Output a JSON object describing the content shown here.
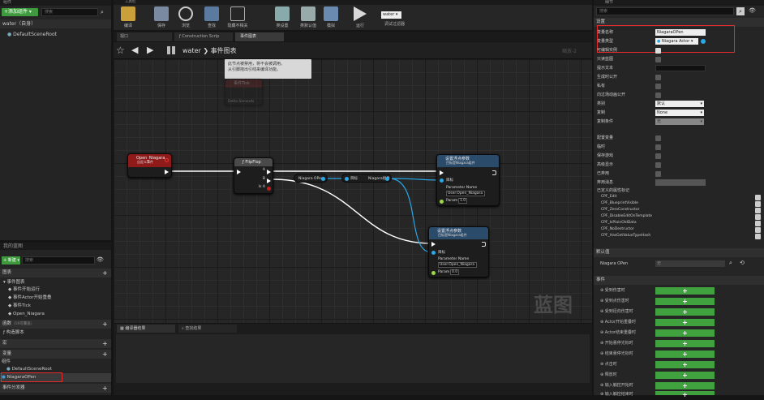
{
  "left_top": {
    "header": "组件",
    "add_button": "+添加组件 ▾",
    "search_placeholder": "搜索",
    "root_item": "water（自身）",
    "child_item": "DefaultSceneRoot"
  },
  "mybp": {
    "header": "我的蓝图",
    "new_button": "+ 新建 ▾",
    "search_placeholder": "搜索",
    "graphs_label": "图表",
    "event_graph": "事件图表",
    "events": [
      "事件开始运行",
      "事件Actor开始重叠",
      "事件Tick",
      "Open_Niagara"
    ],
    "functions_label": "函数",
    "functions_count": "（19可覆盖）",
    "construction": "构造脚本",
    "macros_label": "宏",
    "variables_label": "变量",
    "components_label": "组件",
    "comp_items": [
      "DefaultSceneRoot",
      "NiagaraOPen"
    ],
    "dispatchers_label": "事件分发器"
  },
  "toolbar": {
    "tab": "工具栏",
    "items": [
      "编译",
      "保存",
      "浏览",
      "查找",
      "隐藏不相关",
      "类设置",
      "类默认值",
      "模拟",
      "运行"
    ],
    "debug_label": "water ▾",
    "debug_filter": "调试过滤器"
  },
  "graph_tabs": {
    "viewport": "视口",
    "construction": "Construction Scrip",
    "event_graph": "事件图表"
  },
  "breadcrumb": {
    "root": "water",
    "arrow": "❯",
    "current": "事件图表",
    "zoom": "缩放-2"
  },
  "comment": {
    "text1": "此节点被禁用，将不会被调用。",
    "text2": "从引脚拖出引线来编译功能。"
  },
  "nodes": {
    "disabled_event": {
      "title": "事件Tick",
      "pin": "Delta Seconds"
    },
    "custom_event": {
      "title": "Open_Niagara",
      "subtitle": "自定义事件"
    },
    "flipflop": {
      "title": "FlipFlop",
      "a": "A",
      "b": "B",
      "isa": "Is A"
    },
    "getter": {
      "label": "Niagara OPen"
    },
    "target_pin": {
      "label": "目标"
    },
    "niagara_comp": {
      "label": "Niagara组件"
    },
    "set_param1": {
      "title": "设置浮点参数",
      "subtitle": "目标是Niagara组件",
      "target": "目标",
      "param_name": "Parameter Name",
      "param_value": "User.Open_Niagara",
      "param": "Param",
      "param_val": "1.0"
    },
    "set_param2": {
      "title": "设置浮点参数",
      "subtitle": "目标是Niagara组件",
      "target": "目标",
      "param_name": "Parameter Name",
      "param_value": "User.Open_Niagara",
      "param": "Param",
      "param_val": "0.0"
    }
  },
  "watermark": "蓝图",
  "compiler": {
    "tab1": "编译器结果",
    "tab2": "查找结果"
  },
  "details": {
    "header": "细节",
    "search_placeholder": "搜索",
    "section_settings": "设置",
    "var_name_label": "变量名称",
    "var_name_value": "NiagaraOPen",
    "var_type_label": "变量类型",
    "var_type_value": "Niagara Actor ▾",
    "editable_label": "可编辑实例",
    "readonly_label": "只读蓝图",
    "tooltip_label": "提示文本",
    "generate_label": "生成时公开",
    "private_label": "私有",
    "cinematic_label": "向过场动画公开",
    "category_label": "类别",
    "category_value": "默认",
    "replication_label": "复制",
    "replication_value": "None",
    "repcond_label": "复制条件",
    "repcond_value": "无",
    "config_label": "配置变量",
    "transient_label": "临时",
    "savegame_label": "保存游戏",
    "advanced_label": "高级显示",
    "deprecated_label": "已弃用",
    "deprecation_label": "弃用消息",
    "metadata_label": "已定义的属性标记",
    "flags": [
      "CPF_Edit",
      "CPF_BlueprintVisible",
      "CPF_ZeroConstructor",
      "CPF_DisableEditOnTemplate",
      "CPF_IsPlainOldData",
      "CPF_NoDestructor",
      "CPF_HasGetValueTypeHash"
    ],
    "defaults_section": "默认值",
    "default_name": "Niagara OPen",
    "default_value": "无",
    "events_section": "事件",
    "events": [
      "受到伤害时",
      "受到点伤害时",
      "受到径向伤害时",
      "Actor开始重叠时",
      "Actor结束重叠时",
      "开始悬停光标时",
      "结束悬停光标时",
      "点击时",
      "释放时",
      "输入触控开始时",
      "输入触控结束时"
    ],
    "add_symbol": "+"
  },
  "colors": {
    "accent": "#e52b2b",
    "event_red": "#8e1a1a",
    "blue_pin": "#2aa7e6",
    "green": "#3fa23f"
  }
}
